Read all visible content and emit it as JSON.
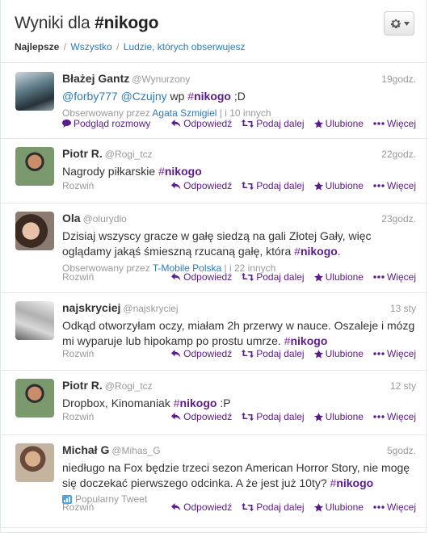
{
  "header": {
    "title_prefix": "Wyniki dla",
    "query": "#nikogo",
    "filters": {
      "active": "Najlepsze",
      "links": [
        "Wszystko",
        "Ludzie, których obserwujesz"
      ],
      "separator": "/"
    }
  },
  "actions": {
    "reply": "Odpowiedź",
    "retweet": "Podaj dalej",
    "favorite": "Ulubione",
    "more": "Więcej",
    "expand": "Rozwiń",
    "conversation": "Podgląd rozmowy"
  },
  "tweets": [
    {
      "name": "Błażej Gantz",
      "username": "@Wynurzony",
      "time": "19godz.",
      "text_parts": [
        "@forby777",
        " ",
        "@Czujny",
        " wp ",
        "#nikogo",
        " ;D"
      ],
      "context_prefix": "Obserwowany przez",
      "context_who": "Agata Szmigiel",
      "context_suffix": "i 10 innych"
    },
    {
      "name": "Piotr R.",
      "username": "@Rogi_tcz",
      "time": "22godz.",
      "text_parts": [
        "Nagrody piłkarskie ",
        "#nikogo"
      ]
    },
    {
      "name": "Ola",
      "username": "@olurydlo",
      "time": "23godz.",
      "text_parts": [
        "Dzisiaj wszyscy gracze w gałę siedzą na gali Złotej Gały, więc oglądamy jakąś śmieszną rzucaną gałę, która ",
        "#nikogo",
        "."
      ],
      "context_prefix": "Obserwowany przez",
      "context_who": "T-Mobile Polska",
      "context_suffix": "i 22 innych"
    },
    {
      "name": "najskryciej",
      "username": "@najskryciej",
      "time": "13 sty",
      "text_parts": [
        "Odkąd otworzyłam oczy, miałam 2h przerwy w nauce. Oszaleje i mózg mi wyparuje lub hipokamp po prostu umrze. ",
        "#nikogo"
      ]
    },
    {
      "name": "Piotr R.",
      "username": "@Rogi_tcz",
      "time": "12 sty",
      "text_parts": [
        "Dropbox, Kinomaniak ",
        "#nikogo",
        " :P"
      ]
    },
    {
      "name": "Michał G",
      "username": "@Mihas_G",
      "time": "5godz.",
      "text_parts": [
        "niedługo na Fox będzie trzeci sezon American Horror Story, nie mogę się doczekać pierwszego odcinka. A że jest już 10ty? ",
        "#nikogo"
      ],
      "promo": "Popularny Tweet"
    }
  ]
}
